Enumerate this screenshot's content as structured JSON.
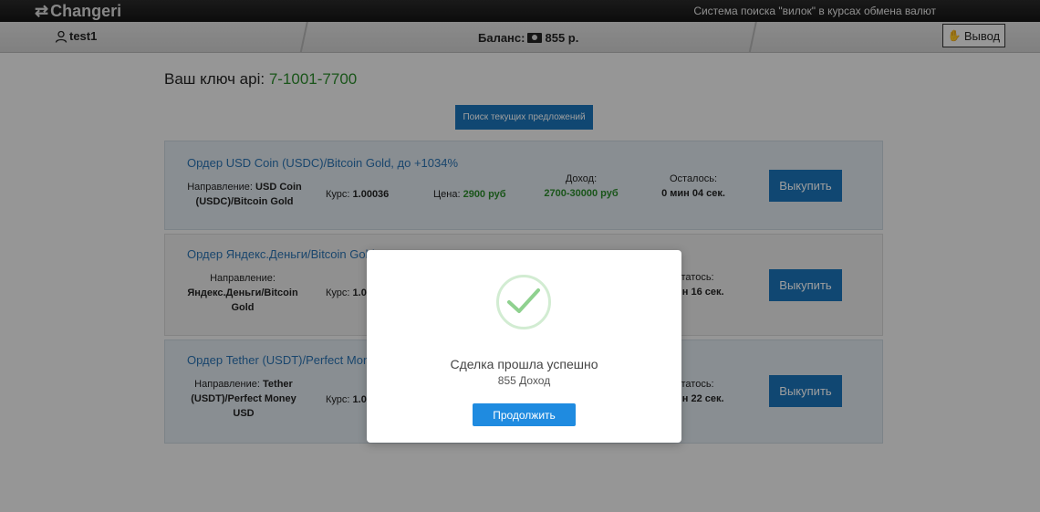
{
  "header": {
    "logo_text": "Changeri",
    "tagline": "Система поиска \"вилок\" в курсах обмена валют"
  },
  "userbar": {
    "username": "test1",
    "balance_label": "Баланс:",
    "balance_value": "855 р.",
    "withdraw_label": "Вывод"
  },
  "main": {
    "api_label": "Ваш ключ api:",
    "api_key": "7-1001-7700",
    "search_button": "Поиск текущих предложений"
  },
  "orders": [
    {
      "title": "Ордер USD Coin (USDC)/Bitcoin Gold, до +1034%",
      "direction_label": "Направление:",
      "direction_value": "USD Coin (USDC)/Bitcoin Gold",
      "rate_label": "Курс:",
      "rate_value": "1.00036",
      "price_label": "Цена:",
      "price_value": "2900 руб",
      "income_label": "Доход:",
      "income_value": "2700-30000 руб",
      "remaining_label": "Осталось:",
      "remaining_value": "0 мин 04 сек.",
      "buy_label": "Выкупить"
    },
    {
      "title": "Ордер Яндекс.Деньги/Bitcoin Gold,",
      "direction_label": "Направление:",
      "direction_value": "Яндекс.Деньги/Bitcoin Gold",
      "rate_label": "Курс:",
      "rate_value": "1.0",
      "remaining_label": "статось:",
      "remaining_value": "ин 16 сек.",
      "buy_label": "Выкупить"
    },
    {
      "title": "Ордер Tether (USDT)/Perfect Money",
      "direction_label": "Направление:",
      "direction_value": "Tether (USDT)/Perfect Money USD",
      "rate_label": "Курс:",
      "rate_value": "1.0",
      "remaining_label": "статось:",
      "remaining_value": "ин 22 сек.",
      "buy_label": "Выкупить"
    }
  ],
  "modal": {
    "title": "Сделка прошла успешно",
    "subtitle": "855 Доход",
    "button": "Продолжить",
    "icon": "check-icon"
  },
  "colors": {
    "accent": "#1a73b8",
    "green": "#2b8a2b"
  }
}
